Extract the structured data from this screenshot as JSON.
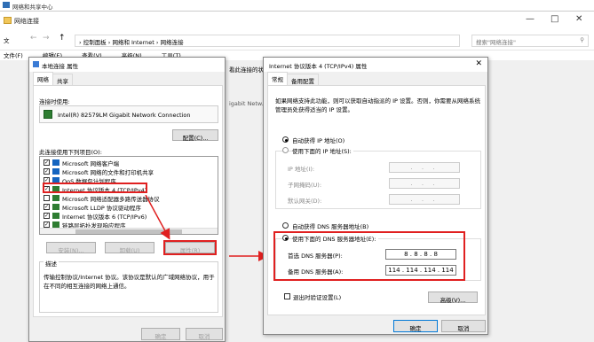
{
  "bg_title": "网络和共享中心",
  "window": {
    "title": "网络连接",
    "controls": [
      "—",
      "□",
      "✕"
    ],
    "nav": {
      "back": "←",
      "forward": "→",
      "up": "↑"
    },
    "address": [
      "控制面板",
      "网络和 Internet",
      "网络连接"
    ],
    "address_sep": "›",
    "search_placeholder": "搜索\"网络连接\"",
    "search_icon": "search-icon",
    "menu": [
      "文件(F)",
      "编辑(E)",
      "查看(V)",
      "高级(N)",
      "工具(T)"
    ],
    "left_fragment": "文",
    "status_fragment": "看此连接的状态",
    "status_fragment2": "igabit Netw..."
  },
  "local_props": {
    "title": "本地连接 属性",
    "tabs": [
      "网络",
      "共享"
    ],
    "connect_using_label": "连接时使用:",
    "adapter": "Intel(R) 82579LM Gigabit Network Connection",
    "configure_btn": "配置(C)...",
    "items_label": "此连接使用下列项目(O):",
    "items": [
      {
        "text": "Microsoft 网络客户端",
        "checked": true
      },
      {
        "text": "Microsoft 网络的文件和打印机共享",
        "checked": true
      },
      {
        "text": "QoS 数据包计划程序",
        "checked": true
      },
      {
        "text": "Internet 协议版本 4 (TCP/IPv4)",
        "checked": true
      },
      {
        "text": "Microsoft 网络适配器多路传送器协议",
        "checked": false
      },
      {
        "text": "Microsoft LLDP 协议驱动程序",
        "checked": true
      },
      {
        "text": "Internet 协议版本 6 (TCP/IPv6)",
        "checked": true
      },
      {
        "text": "链路层拓扑发现响应程序",
        "checked": true
      }
    ],
    "install_btn": "安装(N)...",
    "uninstall_btn": "卸载(U)",
    "properties_btn": "属性(R)",
    "desc_label": "描述",
    "description": "传输控制协议/Internet 协议。该协议是默认的广域网络协议，用于在不同的相互连接的网络上通信。",
    "ok_btn": "确定",
    "cancel_btn": "取消"
  },
  "ipv4": {
    "title": "Internet 协议版本 4 (TCP/IPv4) 属性",
    "tabs": [
      "常规",
      "备用配置"
    ],
    "intro": "如果网络支持此功能，则可以获取自动指派的 IP 设置。否则，你需要从网络系统管理员处获得适当的 IP 设置。",
    "auto_ip": "自动获得 IP 地址(O)",
    "use_ip": "使用下面的 IP 地址(S):",
    "ip_label": "IP 地址(I):",
    "mask_label": "子网掩码(U):",
    "gw_label": "默认网关(D):",
    "empty_ip": ". . .",
    "auto_dns": "自动获得 DNS 服务器地址(B)",
    "use_dns": "使用下面的 DNS 服务器地址(E):",
    "pref_dns_label": "首选 DNS 服务器(P):",
    "pref_dns": "8 . 8 . 8 . 8",
    "alt_dns_label": "备用 DNS 服务器(A):",
    "alt_dns": "114 . 114 . 114 . 114",
    "validate": "退出时验证设置(L)",
    "advanced_btn": "高级(V)...",
    "ok_btn": "确定",
    "cancel_btn": "取消",
    "close": "✕"
  },
  "colors": {
    "highlight": "#e02020",
    "accent": "#0078d7"
  }
}
